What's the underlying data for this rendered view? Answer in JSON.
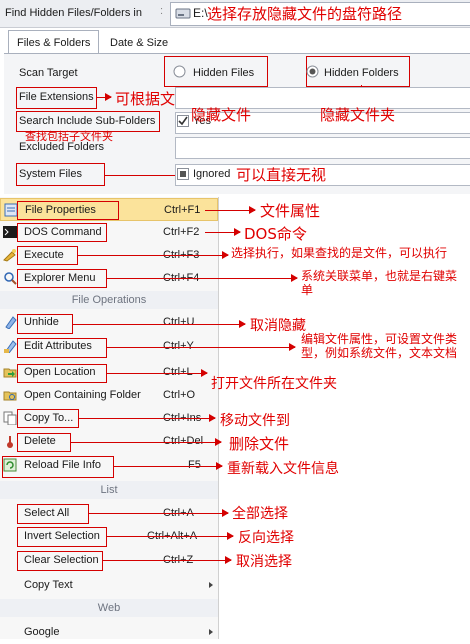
{
  "toolbar": {
    "find_label": "Find Hidden Files/Folders in",
    "path_prefix": "E:\\",
    "path_hint": "选择存放隐藏文件的盘符路径"
  },
  "tabs": [
    {
      "label": "Files & Folders"
    },
    {
      "label": "Date & Size"
    }
  ],
  "form": {
    "scan_target": "Scan Target",
    "hidden_files": "Hidden Files",
    "hidden_folders": "Hidden Folders",
    "file_extensions": "File Extensions",
    "search_sub": "Search Include Sub-Folders",
    "yes": "Yes",
    "excluded": "Excluded Folders",
    "system_files": "System Files",
    "ignored": "Ignored"
  },
  "notes": {
    "ext": "可根据文件后缀进行查找",
    "hidden_file": "隐藏文件",
    "hidden_folder": "隐藏文件夹",
    "sub": "查找包括子文件夹",
    "system": "可以直接无视",
    "props": "文件属性",
    "dos": "DOS命令",
    "execute": "选择执行，如果查找的是文件，可以执行",
    "explorer": "系统关联菜单，也就是右键菜单",
    "unhide": "取消隐藏",
    "edit": "编辑文件属性，可设置文件类型，例如系统文件，文本文档",
    "open_loc": "打开文件所在文件夹",
    "copy": "移动文件到",
    "delete": "删除文件",
    "reload": "重新载入文件信息",
    "select_all": "全部选择",
    "invert": "反向选择",
    "clear": "取消选择"
  },
  "menu": {
    "items": [
      {
        "label": "File Properties",
        "shortcut": "Ctrl+F1"
      },
      {
        "label": "DOS Command",
        "shortcut": "Ctrl+F2"
      },
      {
        "label": "Execute",
        "shortcut": "Ctrl+F3"
      },
      {
        "label": "Explorer Menu",
        "shortcut": "Ctrl+F4"
      },
      {
        "label": "Unhide",
        "shortcut": "Ctrl+U"
      },
      {
        "label": "Edit Attributes",
        "shortcut": "Ctrl+Y"
      },
      {
        "label": "Open Location",
        "shortcut": "Ctrl+L"
      },
      {
        "label": "Open Containing Folder",
        "shortcut": "Ctrl+O"
      },
      {
        "label": "Copy To...",
        "shortcut": "Ctrl+Ins"
      },
      {
        "label": "Delete",
        "shortcut": "Ctrl+Del"
      },
      {
        "label": "Reload File Info",
        "shortcut": "F5"
      },
      {
        "label": "Select All",
        "shortcut": "Ctrl+A"
      },
      {
        "label": "Invert Selection",
        "shortcut": "Ctrl+Alt+A"
      },
      {
        "label": "Clear Selection",
        "shortcut": "Ctrl+Z"
      },
      {
        "label": "Copy Text",
        "shortcut": ""
      },
      {
        "label": "Google",
        "shortcut": ""
      }
    ],
    "sections": {
      "file_ops": "File Operations",
      "list": "List",
      "web": "Web"
    }
  }
}
